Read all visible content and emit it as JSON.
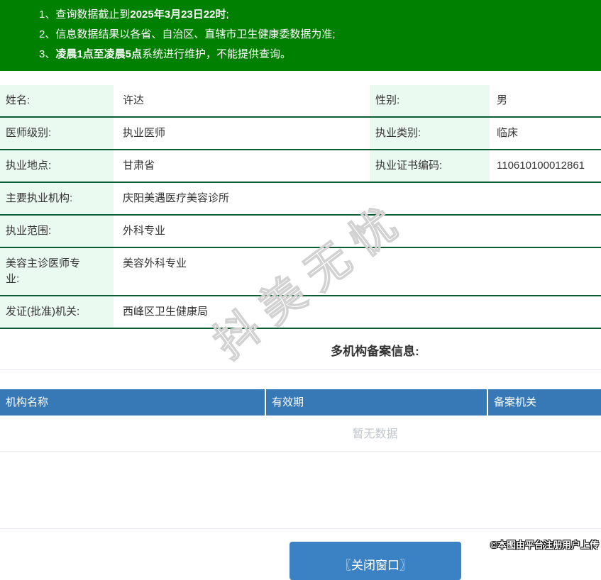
{
  "colors": {
    "banner_green": "#008000",
    "label_cell_mint": "#eafaf1",
    "row_border_green": "#0a5c32",
    "header_blue": "#3779b7",
    "button_blue": "#3b82c4",
    "empty_text_gray": "#c0c4cc"
  },
  "banner": {
    "lines": [
      {
        "num": "1、",
        "pre": "查询数据截止到",
        "bold": "2025年3月23日22时",
        "post": ";"
      },
      {
        "num": "2、",
        "pre": "信息数据结果以各省、自治区、直辖市卫生健康委数据为准;",
        "bold": "",
        "post": ""
      },
      {
        "num": "3、",
        "pre": "",
        "bold": "凌晨1点至凌晨5点",
        "post": "系统进行维护，不能提供查询。"
      }
    ]
  },
  "info": {
    "rows": [
      {
        "label1": "姓名:",
        "value1": "许达",
        "label2": "性别:",
        "value2": "男"
      },
      {
        "label1": "医师级别:",
        "value1": "执业医师",
        "label2": "执业类别:",
        "value2": "临床"
      },
      {
        "label1": "执业地点:",
        "value1": "甘肃省",
        "label2": "执业证书编码:",
        "value2": "110610100012861"
      },
      {
        "label1": "主要执业机构:",
        "value1": "庆阳美遇医疗美容诊所"
      },
      {
        "label1": "执业范围:",
        "value1": "外科专业"
      },
      {
        "label1": "美容主诊医师专业:",
        "value1": "美容外科专业"
      },
      {
        "label1": "发证(批准)机关:",
        "value1": "西峰区卫生健康局"
      }
    ]
  },
  "section": {
    "title": "多机构备案信息:"
  },
  "registry": {
    "headers": [
      "机构名称",
      "有效期",
      "备案机关"
    ],
    "empty_text": "暂无数据"
  },
  "footer": {
    "close_button": "〖关闭窗口〗",
    "caption": "©本图由平台注册用户上传"
  },
  "watermark": {
    "text": "抖美无忧"
  }
}
